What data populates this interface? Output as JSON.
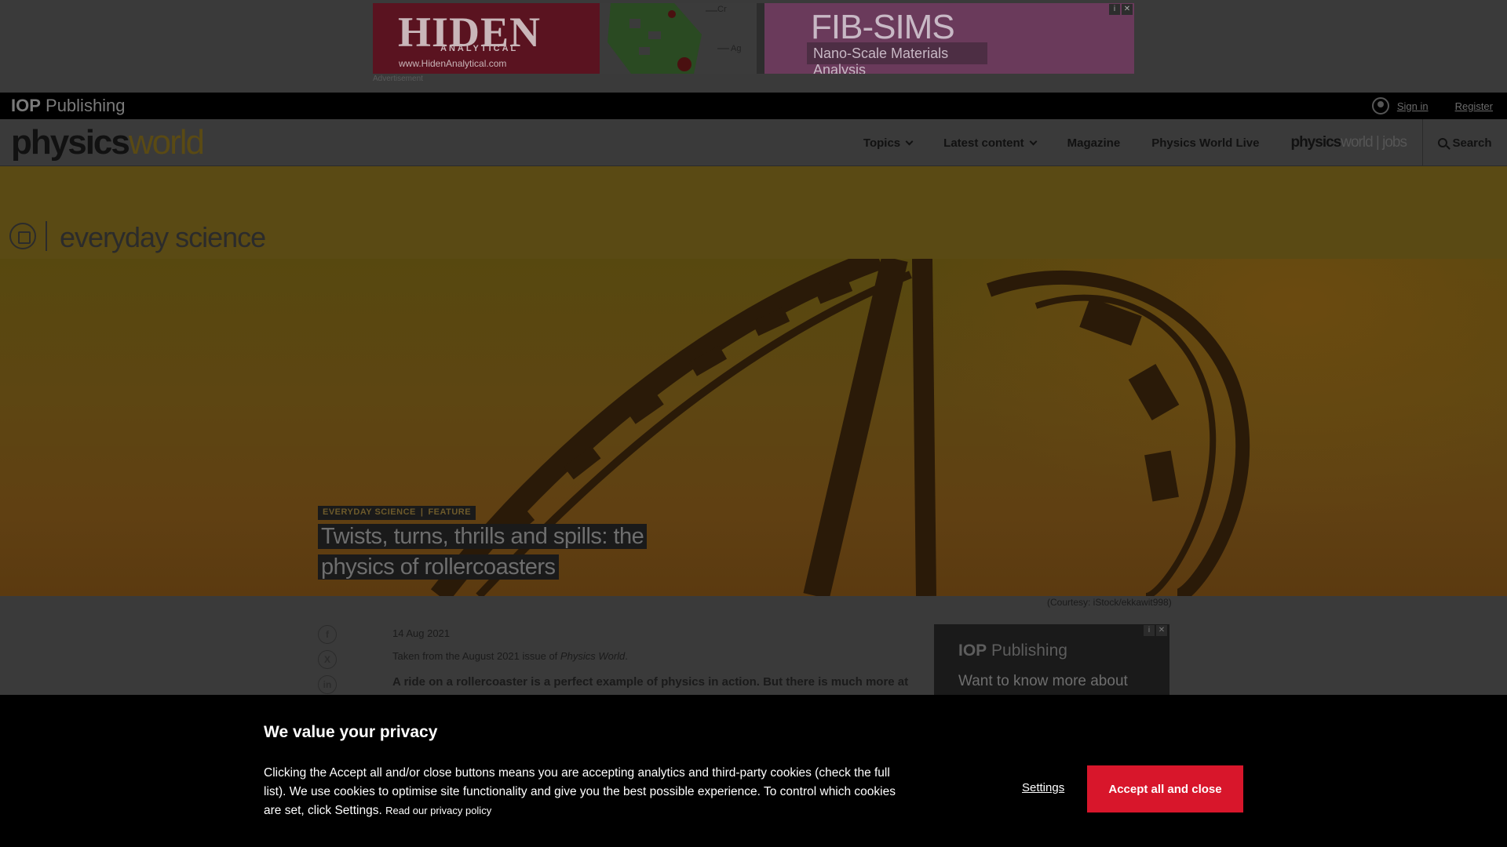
{
  "ads": {
    "top_banner": {
      "brand": "HIDEN",
      "brand_sub": "ANALYTICAL",
      "url": "www.HidenAnalytical.com",
      "tag_cr": "Cr",
      "tag_ag": "Ag",
      "headline": "FIB-SIMS",
      "subline": "Nano-Scale Materials Analysis"
    },
    "label": "Advertisement",
    "side": {
      "brand_bold": "IOP",
      "brand_rest": " Publishing",
      "text": "Want to know more about"
    }
  },
  "topbar": {
    "publisher_bold": "IOP",
    "publisher_rest": " Publishing",
    "sign_in": "Sign in",
    "register": "Register"
  },
  "nav": {
    "logo_a": "physics",
    "logo_b": "world",
    "items": [
      "Topics",
      "Latest content",
      "Magazine",
      "Physics World Live"
    ],
    "jobs_a": "physics",
    "jobs_b": "world",
    "jobs_c": "jobs",
    "search": "Search"
  },
  "section": {
    "title": "everyday science"
  },
  "hero": {
    "kicker_1": "EVERYDAY SCIENCE",
    "kicker_sep": "|",
    "kicker_2": "FEATURE",
    "title": "Twists, turns, thrills and spills: the physics of rollercoasters",
    "credit": "(Courtesy: iStock/ekkawit998)"
  },
  "article": {
    "date": "14 Aug 2021",
    "source_prefix": "Taken from the August 2021 issue of ",
    "source_mag": "Physics World",
    "source_suffix": ".",
    "lead": "A ride on a rollercoaster is a perfect example of physics in action. But there is much more at",
    "share": [
      "f",
      "X",
      "in"
    ]
  },
  "cookie": {
    "title": "We value your privacy",
    "body": "Clicking the Accept all and/or close buttons means you are accepting analytics and third-party cookies (check the full list). We use cookies to optimise site functionality and give you the best possible experience. To control which cookies are set, click Settings.",
    "privacy_link": "Read our privacy policy",
    "settings": "Settings",
    "accept": "Accept all and close"
  },
  "colors": {
    "accent_red": "#d8162b",
    "section_gold": "#5a4a14",
    "overlay": "#000000"
  }
}
